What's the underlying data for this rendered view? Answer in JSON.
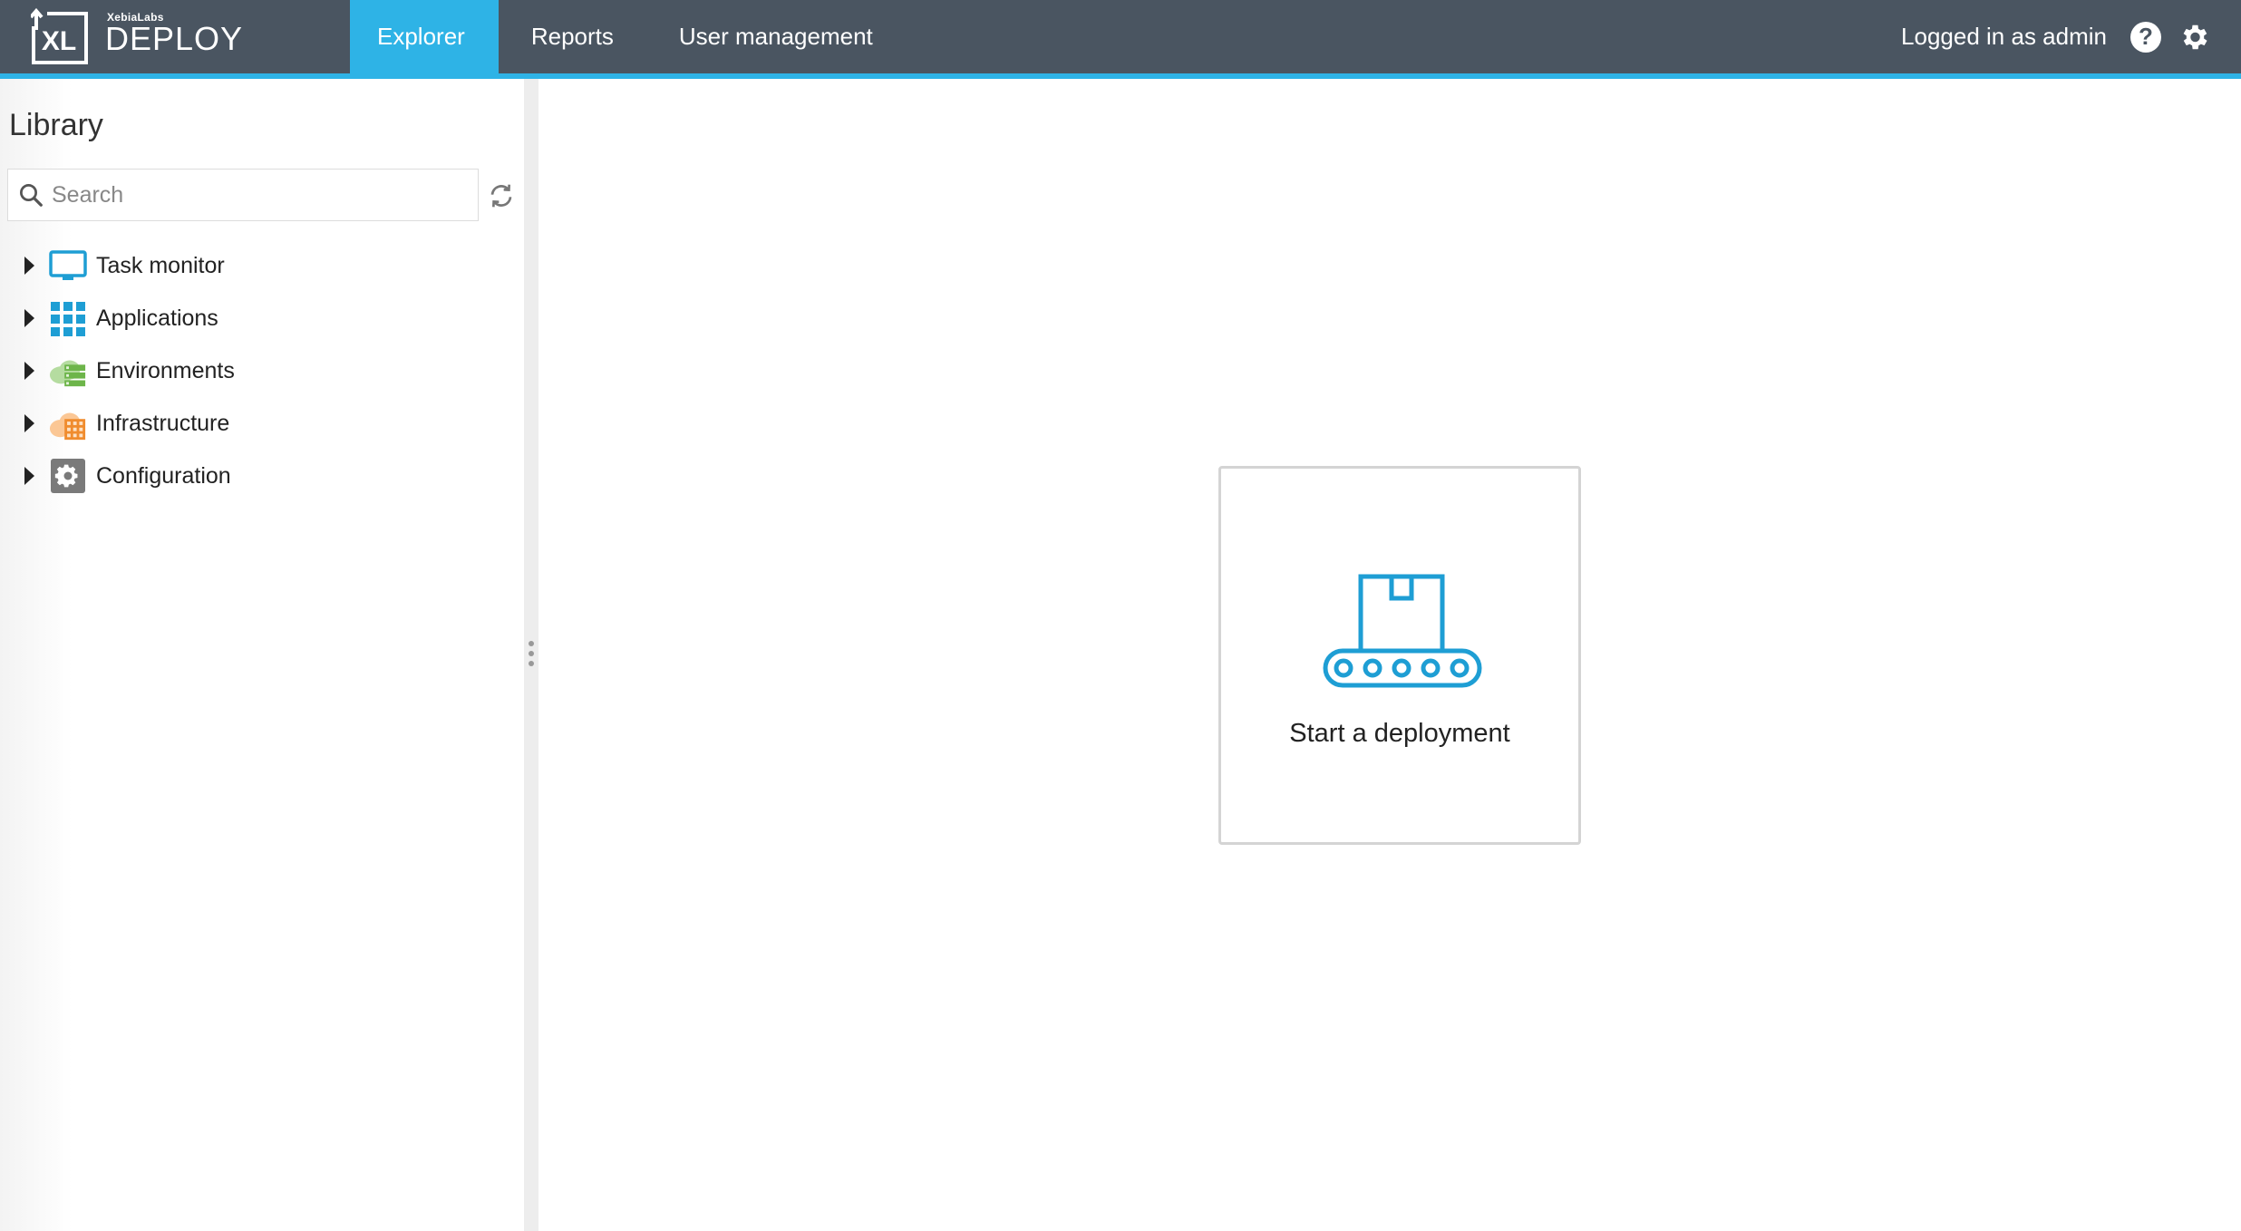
{
  "header": {
    "logo_company": "XebiaLabs",
    "logo_mark": "XL",
    "logo_product": "DEPLOY",
    "tabs": [
      {
        "label": "Explorer",
        "active": true
      },
      {
        "label": "Reports",
        "active": false
      },
      {
        "label": "User management",
        "active": false
      }
    ],
    "user_status": "Logged in as admin",
    "help_icon": "question-circle-icon",
    "settings_icon": "gear-icon"
  },
  "sidebar": {
    "title": "Library",
    "search": {
      "placeholder": "Search",
      "value": ""
    },
    "refresh_icon": "refresh-icon",
    "items": [
      {
        "label": "Task monitor",
        "icon": "monitor-icon"
      },
      {
        "label": "Applications",
        "icon": "grid-icon"
      },
      {
        "label": "Environments",
        "icon": "cloud-server-icon"
      },
      {
        "label": "Infrastructure",
        "icon": "cloud-building-icon"
      },
      {
        "label": "Configuration",
        "icon": "settings-box-icon"
      }
    ]
  },
  "main": {
    "card_label": "Start a deployment",
    "card_icon": "conveyor-icon"
  },
  "colors": {
    "header_bg": "#4a5561",
    "accent": "#2eb3e6",
    "icon_blue": "#1e9ed4",
    "env_green": "#7cbf5a",
    "infra_orange": "#f5a14a",
    "config_gray": "#7a7a7a"
  }
}
